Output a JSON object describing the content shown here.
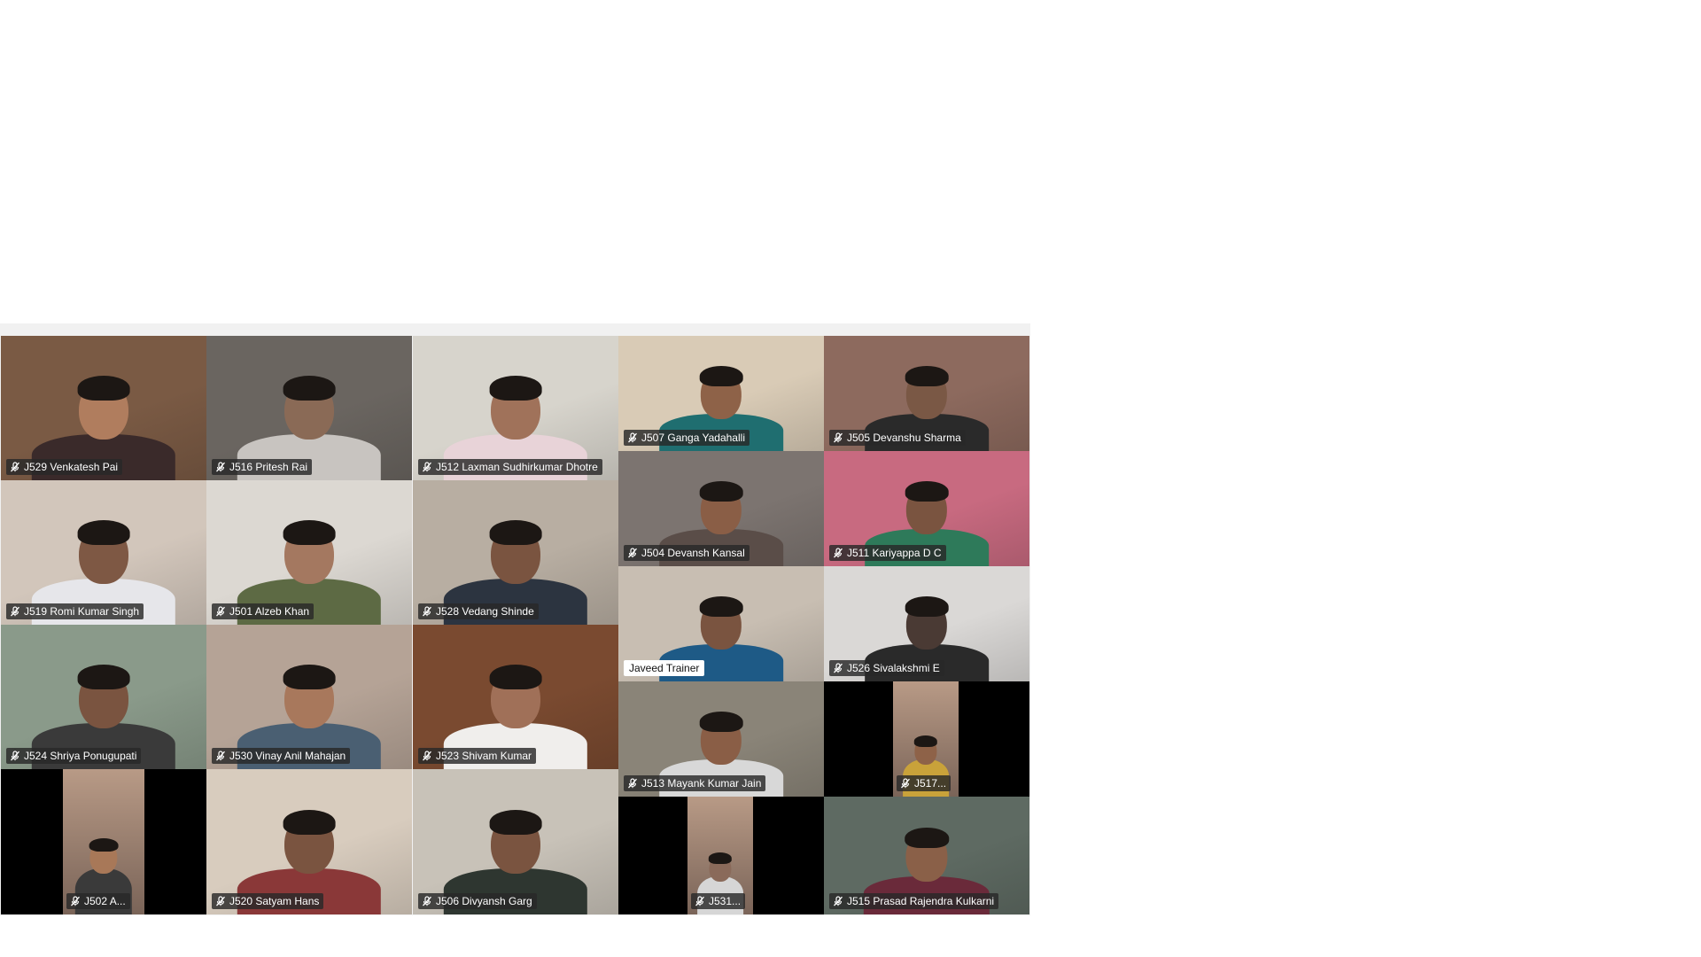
{
  "participants": [
    {
      "label": "J529 Venkatesh Pai",
      "muted": true,
      "bg": "#7a5a44",
      "skin": "#b07d5e",
      "shirt": "#3a2a2a"
    },
    {
      "label": "J516 Pritesh Rai",
      "muted": true,
      "bg": "#6a6560",
      "skin": "#8a6a56",
      "shirt": "#c8c4c0"
    },
    {
      "label": "J512 Laxman Sudhirkumar Dhotre",
      "muted": true,
      "bg": "#d7d4cc",
      "skin": "#a0725a",
      "shirt": "#e8d3d8"
    },
    {
      "label": "J507 Ganga Yadahalli",
      "muted": true,
      "bg": "#d9cbb6",
      "skin": "#8e6248",
      "shirt": "#1f6e70"
    },
    {
      "label": "J505 Devanshu Sharma",
      "muted": true,
      "bg": "#8d6a5e",
      "skin": "#7a5845",
      "shirt": "#2a2a2a"
    },
    {
      "label": "J519 Romi Kumar Singh",
      "muted": true,
      "bg": "#d2c6bb",
      "skin": "#7e5844",
      "shirt": "#e6e6ea"
    },
    {
      "label": "J501 Alzeb Khan",
      "muted": true,
      "bg": "#dcd8d2",
      "skin": "#a47860",
      "shirt": "#5d6a44"
    },
    {
      "label": "J528 Vedang Shinde",
      "muted": true,
      "bg": "#b8aea2",
      "skin": "#7a5440",
      "shirt": "#2c3440"
    },
    {
      "label": "J504 Devansh Kansal",
      "muted": true,
      "bg": "#7c7470",
      "skin": "#8a5e46",
      "shirt": "#5a4d48"
    },
    {
      "label": "J511 Kariyappa D C",
      "muted": true,
      "bg": "#c86a80",
      "skin": "#7a5440",
      "shirt": "#2e7a5a"
    },
    {
      "label": "J524 Shriya Ponugupati",
      "muted": true,
      "bg": "#8a9a8a",
      "skin": "#7a5440",
      "shirt": "#3a3a3a"
    },
    {
      "label": "J530 Vinay Anil Mahajan",
      "muted": true,
      "bg": "#b5a396",
      "skin": "#a8785c",
      "shirt": "#4a5f72"
    },
    {
      "label": "J523 Shivam Kumar",
      "muted": true,
      "bg": "#7a4a30",
      "skin": "#a07058",
      "shirt": "#f0eeec"
    },
    {
      "label": "Javeed Trainer",
      "muted": false,
      "bg": "#c8beb2",
      "skin": "#7a5440",
      "shirt": "#1e5a86"
    },
    {
      "label": "J526 Sivalakshmi E",
      "muted": true,
      "bg": "#dad8d6",
      "skin": "#4a3a34",
      "shirt": "#2a2a2a"
    },
    {
      "label": "J513 Mayank Kumar Jain",
      "muted": true,
      "bg": "#8a8478",
      "skin": "#8a5e46",
      "shirt": "#d8d8d8"
    },
    {
      "label": "J517...",
      "muted": true,
      "bg": "#000000",
      "skin": "#8e6248",
      "shirt": "#c9a23a"
    },
    {
      "label": "J502 A...",
      "muted": true,
      "bg": "#000000",
      "skin": "#a87858",
      "shirt": "#3a3a3a"
    },
    {
      "label": "J520 Satyam Hans",
      "muted": true,
      "bg": "#d8ccbe",
      "skin": "#7a5440",
      "shirt": "#8a3838"
    },
    {
      "label": "J506 Divyansh Garg",
      "muted": true,
      "bg": "#c8c2b8",
      "skin": "#7a5440",
      "shirt": "#2e3630"
    },
    {
      "label": "J531...",
      "muted": true,
      "bg": "#000000",
      "skin": "#8a6a5a",
      "shirt": "#d6d6d6"
    },
    {
      "label": "J515 Prasad Rajendra Kulkarni",
      "muted": true,
      "bg": "#5e6a62",
      "skin": "#8a6048",
      "shirt": "#6a2a3a"
    }
  ]
}
